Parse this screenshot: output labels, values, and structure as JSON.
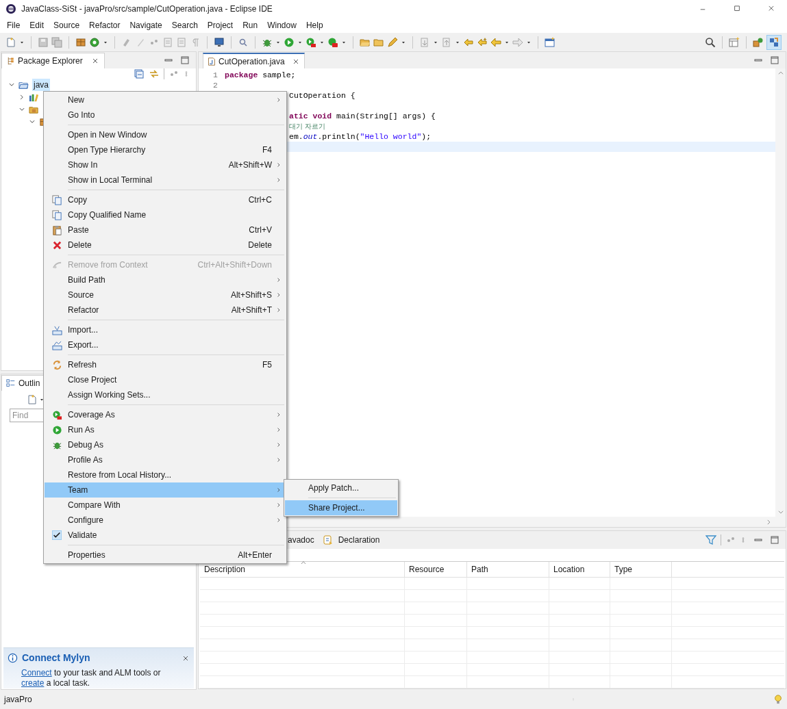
{
  "window": {
    "title": "JavaClass-SiSt - javaPro/src/sample/CutOperation.java - Eclipse IDE"
  },
  "menu_bar": [
    "File",
    "Edit",
    "Source",
    "Refactor",
    "Navigate",
    "Search",
    "Project",
    "Run",
    "Window",
    "Help"
  ],
  "package_explorer": {
    "title": "Package Explorer",
    "tree": [
      {
        "label": "java",
        "kind": "project",
        "selected": true,
        "expanded": true,
        "children": [
          {
            "kind": "library",
            "expanded": false
          },
          {
            "kind": "source",
            "expanded": true,
            "children": [
              {
                "kind": "package",
                "expanded": true
              }
            ]
          }
        ]
      }
    ]
  },
  "outline": {
    "title": "Outlin",
    "search": {
      "placeholder": "Find"
    }
  },
  "mylyn": {
    "title": "Connect Mylyn",
    "parts": [
      {
        "text": "Connect",
        "link": true
      },
      {
        "text": " to your task and ALM tools or ",
        "link": false
      },
      {
        "text": "create",
        "link": true
      },
      {
        "text": " a local task.",
        "link": false
      }
    ]
  },
  "editor": {
    "tabs": [
      {
        "label": "CutOperation.java",
        "selected": true
      }
    ],
    "lines": [
      {
        "number": "1",
        "kind": "full",
        "current": false,
        "segments": [
          {
            "kind": "keyword",
            "text": "package"
          },
          {
            "kind": "plain",
            "text": " sample;"
          }
        ]
      },
      {
        "number": "2",
        "kind": "full",
        "current": false
      },
      {
        "kind": "partial",
        "current": false,
        "segments": [
          {
            "kind": "plain",
            "text": "CutOperation {"
          }
        ]
      },
      {
        "kind": "partial",
        "current": false
      },
      {
        "kind": "partial",
        "current": false,
        "segments": [
          {
            "kind": "keyword",
            "text": "atic void"
          },
          {
            "kind": "plain",
            "text": " main(String[] args) {"
          }
        ]
      },
      {
        "kind": "partial",
        "current": false,
        "segments": [
          {
            "kind": "comment",
            "text": "대기 자르기"
          }
        ]
      },
      {
        "kind": "partial",
        "current": false,
        "segments": [
          {
            "kind": "plain",
            "text": "em."
          },
          {
            "kind": "field",
            "text": "out"
          },
          {
            "kind": "plain",
            "text": ".println("
          },
          {
            "kind": "string",
            "text": "\"Hello world\""
          },
          {
            "kind": "plain",
            "text": ");"
          }
        ]
      },
      {
        "kind": "partial",
        "current": true
      }
    ]
  },
  "context_menu": {
    "groups": [
      [
        {
          "label": "New",
          "kind": "plain",
          "submenu": true,
          "disabled": false,
          "selected": false,
          "checked": false
        },
        {
          "label": "Go Into",
          "kind": "plain",
          "submenu": false,
          "disabled": false,
          "selected": false,
          "checked": false
        }
      ],
      [
        {
          "label": "Open in New Window",
          "kind": "plain",
          "submenu": false,
          "disabled": false,
          "selected": false,
          "checked": false
        },
        {
          "label": "Open Type Hierarchy",
          "shortcut": "F4",
          "kind": "plain",
          "submenu": false,
          "disabled": false,
          "selected": false,
          "checked": false
        },
        {
          "label": "Show In",
          "shortcut": "Alt+Shift+W",
          "kind": "plain",
          "submenu": true,
          "disabled": false,
          "selected": false,
          "checked": false
        },
        {
          "label": "Show in Local Terminal",
          "kind": "plain",
          "submenu": true,
          "disabled": false,
          "selected": false,
          "checked": false
        }
      ],
      [
        {
          "label": "Copy",
          "shortcut": "Ctrl+C",
          "kind": "copy",
          "submenu": false,
          "disabled": false,
          "selected": false,
          "checked": false
        },
        {
          "label": "Copy Qualified Name",
          "kind": "copy",
          "submenu": false,
          "disabled": false,
          "selected": false,
          "checked": false
        },
        {
          "label": "Paste",
          "shortcut": "Ctrl+V",
          "kind": "paste",
          "submenu": false,
          "disabled": false,
          "selected": false,
          "checked": false
        },
        {
          "label": "Delete",
          "shortcut": "Delete",
          "kind": "delete",
          "submenu": false,
          "disabled": false,
          "selected": false,
          "checked": false
        }
      ],
      [
        {
          "label": "Remove from Context",
          "shortcut": "Ctrl+Alt+Shift+Down",
          "kind": "remove",
          "submenu": false,
          "disabled": true,
          "selected": false,
          "checked": false
        },
        {
          "label": "Build Path",
          "kind": "plain",
          "submenu": true,
          "disabled": false,
          "selected": false,
          "checked": false
        },
        {
          "label": "Source",
          "shortcut": "Alt+Shift+S",
          "kind": "plain",
          "submenu": true,
          "disabled": false,
          "selected": false,
          "checked": false
        },
        {
          "label": "Refactor",
          "shortcut": "Alt+Shift+T",
          "kind": "plain",
          "submenu": true,
          "disabled": false,
          "selected": false,
          "checked": false
        }
      ],
      [
        {
          "label": "Import...",
          "kind": "import",
          "submenu": false,
          "disabled": false,
          "selected": false,
          "checked": false
        },
        {
          "label": "Export...",
          "kind": "export",
          "submenu": false,
          "disabled": false,
          "selected": false,
          "checked": false
        }
      ],
      [
        {
          "label": "Refresh",
          "shortcut": "F5",
          "kind": "refresh",
          "submenu": false,
          "disabled": false,
          "selected": false,
          "checked": false
        },
        {
          "label": "Close Project",
          "kind": "plain",
          "submenu": false,
          "disabled": false,
          "selected": false,
          "checked": false
        },
        {
          "label": "Assign Working Sets...",
          "kind": "plain",
          "submenu": false,
          "disabled": false,
          "selected": false,
          "checked": false
        }
      ],
      [
        {
          "label": "Coverage As",
          "kind": "coverage",
          "submenu": true,
          "disabled": false,
          "selected": false,
          "checked": false
        },
        {
          "label": "Run As",
          "kind": "run",
          "submenu": true,
          "disabled": false,
          "selected": false,
          "checked": false
        },
        {
          "label": "Debug As",
          "kind": "debug",
          "submenu": true,
          "disabled": false,
          "selected": false,
          "checked": false
        },
        {
          "label": "Profile As",
          "kind": "plain",
          "submenu": true,
          "disabled": false,
          "selected": false,
          "checked": false
        },
        {
          "label": "Restore from Local History...",
          "kind": "plain",
          "submenu": false,
          "disabled": false,
          "selected": false,
          "checked": false
        },
        {
          "label": "Team",
          "kind": "plain",
          "submenu": true,
          "disabled": false,
          "selected": true,
          "checked": false
        },
        {
          "label": "Compare With",
          "kind": "plain",
          "submenu": true,
          "disabled": false,
          "selected": false,
          "checked": false
        },
        {
          "label": "Configure",
          "kind": "plain",
          "submenu": true,
          "disabled": false,
          "selected": false,
          "checked": false
        },
        {
          "label": "Validate",
          "kind": "plain",
          "submenu": false,
          "disabled": false,
          "selected": false,
          "checked": true
        }
      ],
      [
        {
          "label": "Properties",
          "shortcut": "Alt+Enter",
          "kind": "plain",
          "submenu": false,
          "disabled": false,
          "selected": false,
          "checked": false
        }
      ]
    ]
  },
  "submenu": {
    "groups": [
      [
        {
          "label": "Apply Patch...",
          "selected": false
        }
      ],
      [
        {
          "label": "Share Project...",
          "selected": true
        }
      ]
    ]
  },
  "bottom_panel": {
    "tabs": [
      {
        "label": "avadoc",
        "selected": false
      },
      {
        "label": "Declaration",
        "selected": false
      }
    ],
    "table": {
      "columns": [
        "Description",
        "Resource",
        "Path",
        "Location",
        "Type"
      ]
    }
  },
  "status_bar": {
    "text": "javaPro"
  }
}
